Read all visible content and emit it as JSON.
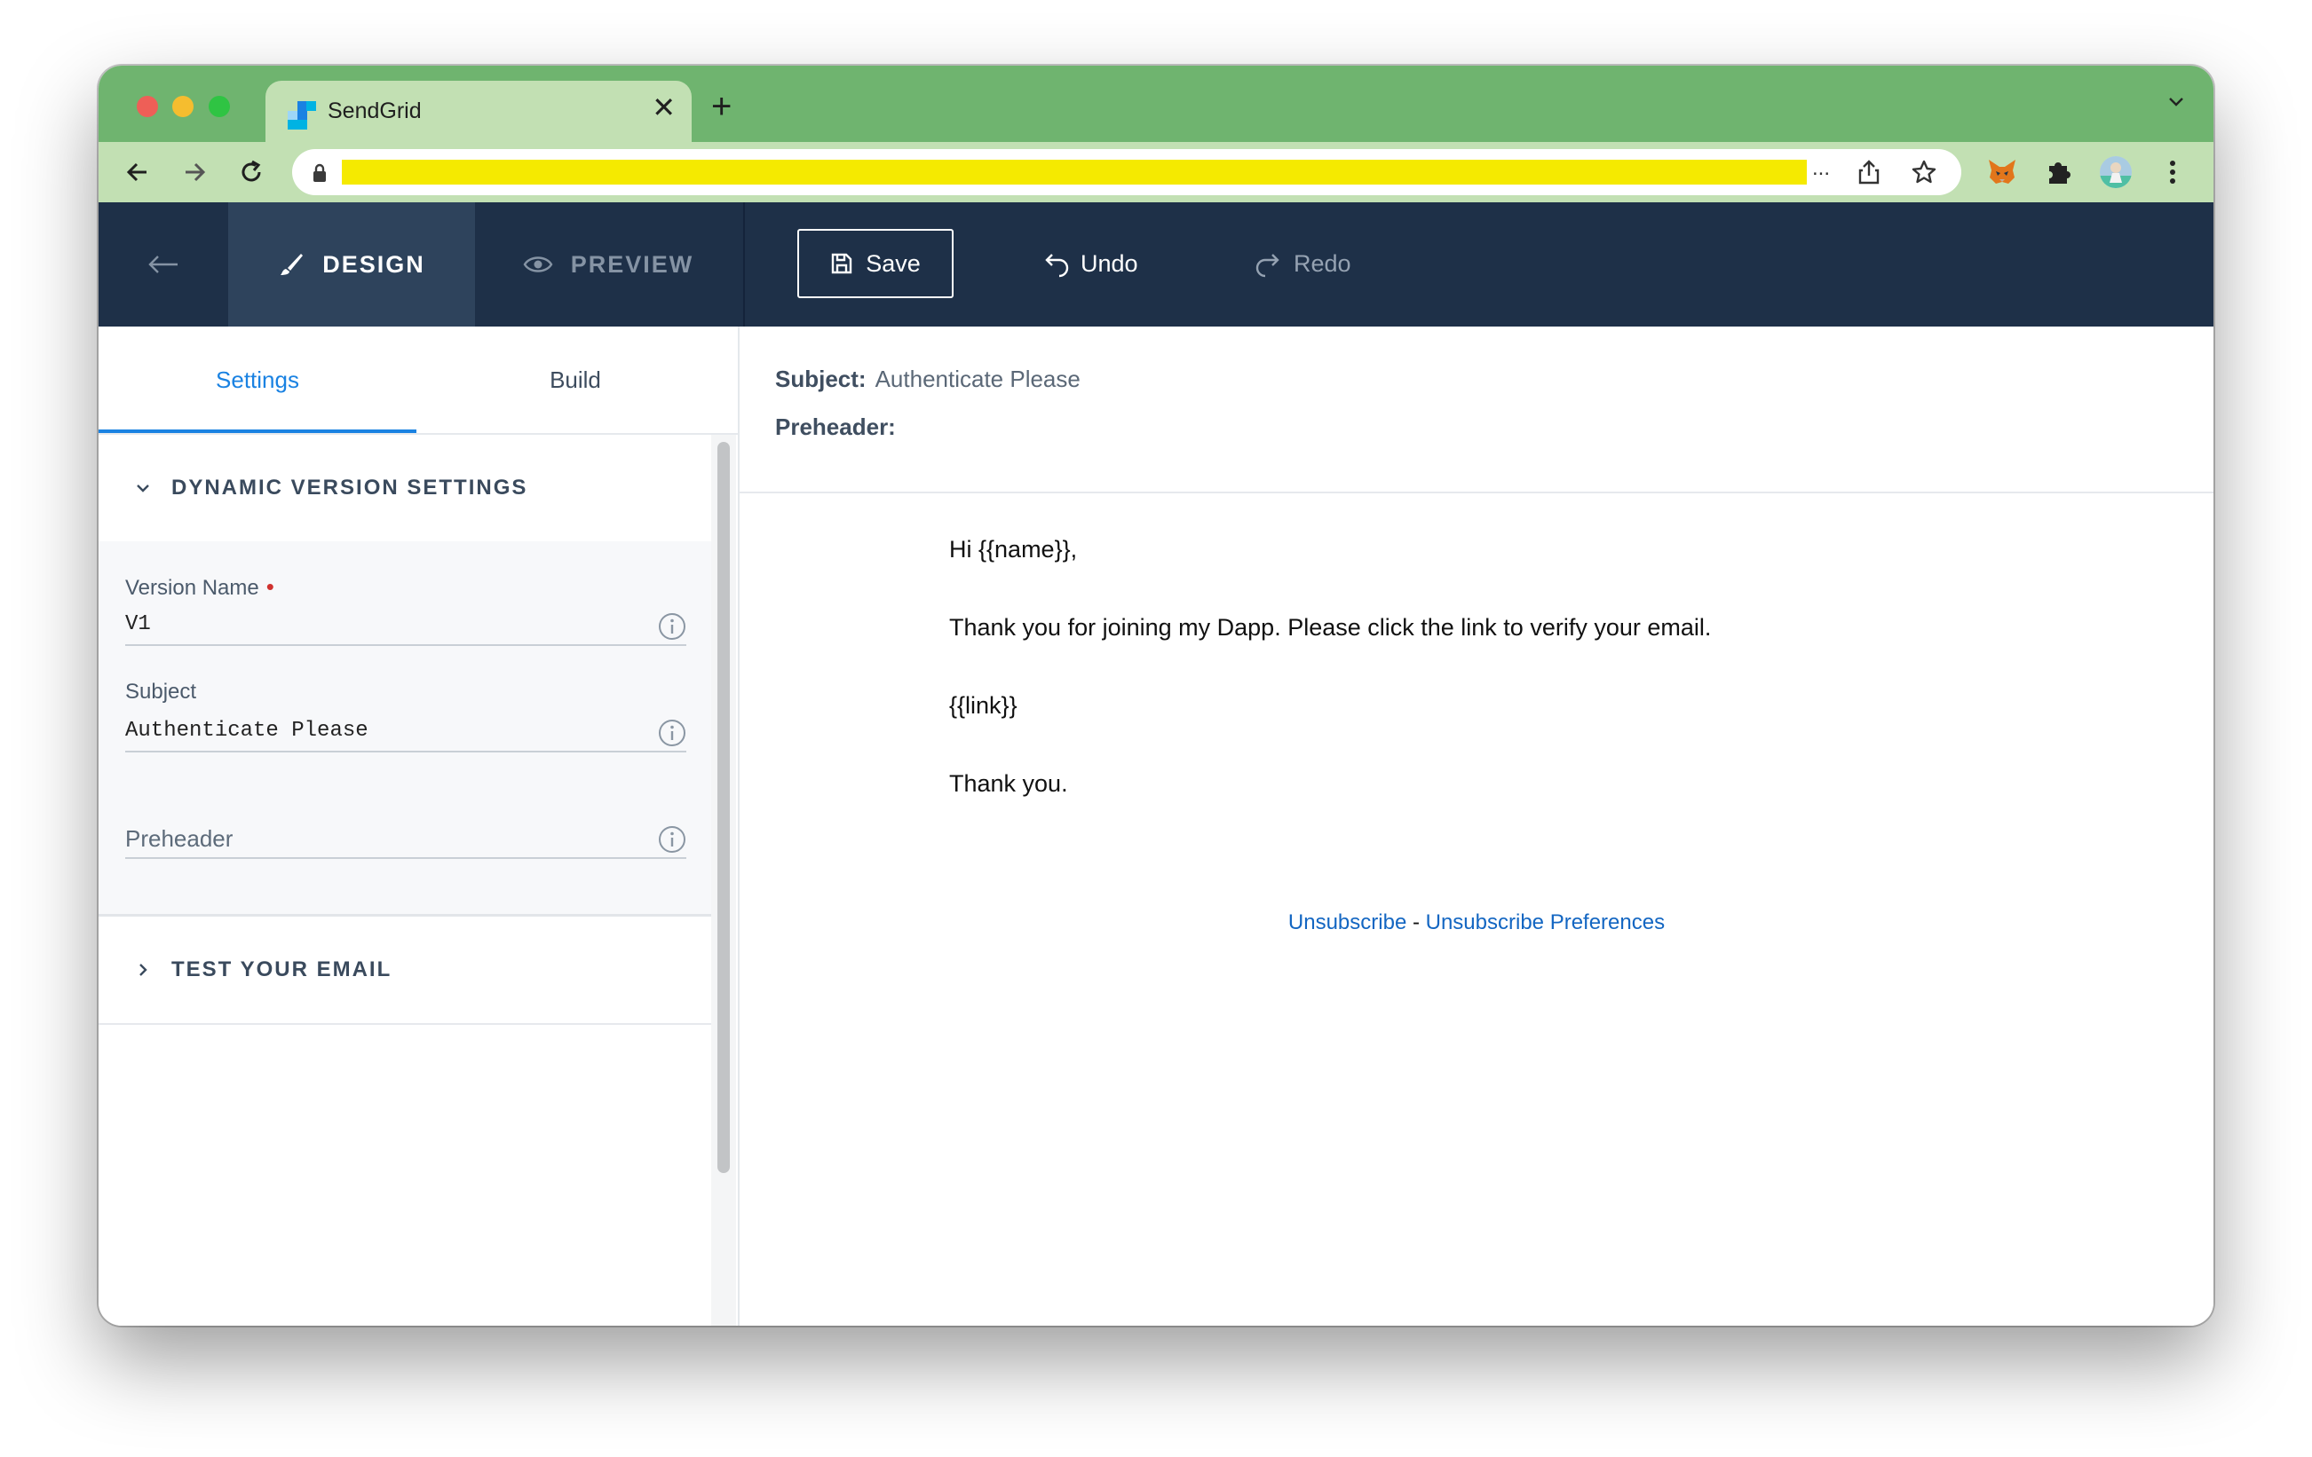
{
  "browser": {
    "tab_title": "SendGrid",
    "url_ellipsis": "...",
    "new_tab_symbol": "+",
    "close_symbol": "✕"
  },
  "header": {
    "design_label": "DESIGN",
    "preview_label": "PREVIEW",
    "save_label": "Save",
    "undo_label": "Undo",
    "redo_label": "Redo"
  },
  "left_panel": {
    "tabs": [
      {
        "label": "Settings",
        "active": true
      },
      {
        "label": "Build",
        "active": false
      }
    ],
    "dynamic_section_title": "DYNAMIC VERSION SETTINGS",
    "fields": {
      "version_name": {
        "label": "Version Name",
        "required": true,
        "required_marker": "•",
        "value": "V1"
      },
      "subject": {
        "label": "Subject",
        "value": "Authenticate Please"
      },
      "preheader": {
        "placeholder": "Preheader",
        "value": ""
      }
    },
    "test_section_title": "TEST YOUR EMAIL"
  },
  "preview": {
    "subject_label": "Subject:",
    "subject_value": "Authenticate Please",
    "preheader_label": "Preheader:",
    "preheader_value": "",
    "body_lines": [
      "Hi {{name}},",
      "Thank you for joining my Dapp. Please click the link to verify your email.",
      "{{link}}",
      "Thank you."
    ],
    "footer": {
      "unsubscribe": "Unsubscribe",
      "separator": " - ",
      "unsubscribe_preferences": "Unsubscribe Preferences"
    }
  },
  "colors": {
    "tab_strip": "#6fb46f",
    "toolbar": "#c2e0b3",
    "app_header": "#1e3048",
    "accent": "#1a82e2",
    "link": "#1366c2",
    "url_redaction": "#f5ea00"
  }
}
